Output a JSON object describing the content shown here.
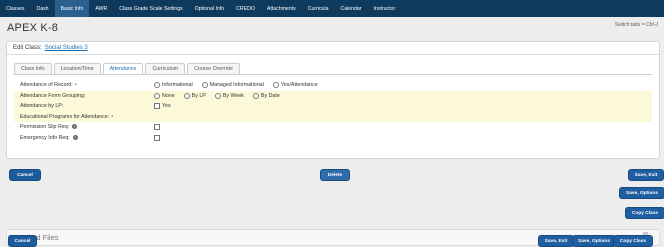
{
  "nav": {
    "items": [
      {
        "label": "Classes",
        "active": false
      },
      {
        "label": "Dash",
        "active": false
      },
      {
        "label": "Basic Info",
        "active": true
      },
      {
        "label": "AWR",
        "active": false
      },
      {
        "label": "Class Grade Scale Settings",
        "active": false
      },
      {
        "label": "Optional Info",
        "active": false
      },
      {
        "label": "CREDO",
        "active": false
      },
      {
        "label": "Attachments",
        "active": false
      },
      {
        "label": "Curricula",
        "active": false
      },
      {
        "label": "Calendar",
        "active": false
      },
      {
        "label": "Instructor",
        "active": false
      }
    ]
  },
  "page": {
    "title": "APEX K-8",
    "switch_hint": "Switch tabs = Ctrl-J"
  },
  "edit_class": {
    "prefix": "Edit Class:",
    "name": "Social Studies 3"
  },
  "tabs": [
    {
      "label": "Class Info",
      "active": false
    },
    {
      "label": "Location/Time",
      "active": false
    },
    {
      "label": "Attendance",
      "active": true
    },
    {
      "label": "Curriculum",
      "active": false
    },
    {
      "label": "Course Override",
      "active": false
    }
  ],
  "form": {
    "attendance_of_record": {
      "label": "Attendance of Record:",
      "options": [
        "Informational",
        "Managed Informational",
        "Yes/Attendance"
      ]
    },
    "attendance_form_grouping": {
      "label": "Attendance Form Grouping:",
      "options": [
        "None",
        "By LP",
        "By Week",
        "By Date"
      ]
    },
    "attendance_by_lp": {
      "label": "Attendance by LP:",
      "option": "Yes"
    },
    "educational_programs": {
      "label": "Educational Programs for Attendance:"
    },
    "permission_slip": {
      "label": "Permission Slip Req:"
    },
    "emergency_info": {
      "label": "Emergency Info Req:"
    }
  },
  "buttons": {
    "cancel": "Cancel",
    "delete": "Delete",
    "save_exit": "Save, Exit",
    "save_options": "Save, Options",
    "copy_class": "Copy Class"
  },
  "attached_files": {
    "title": "ttached Files"
  },
  "colors": {
    "nav_bg": "#0e3a5e",
    "nav_active": "#2b5f8f",
    "button": "#1f5ea0",
    "link": "#1c6fb0",
    "highlight_row": "#fbf9d8"
  }
}
